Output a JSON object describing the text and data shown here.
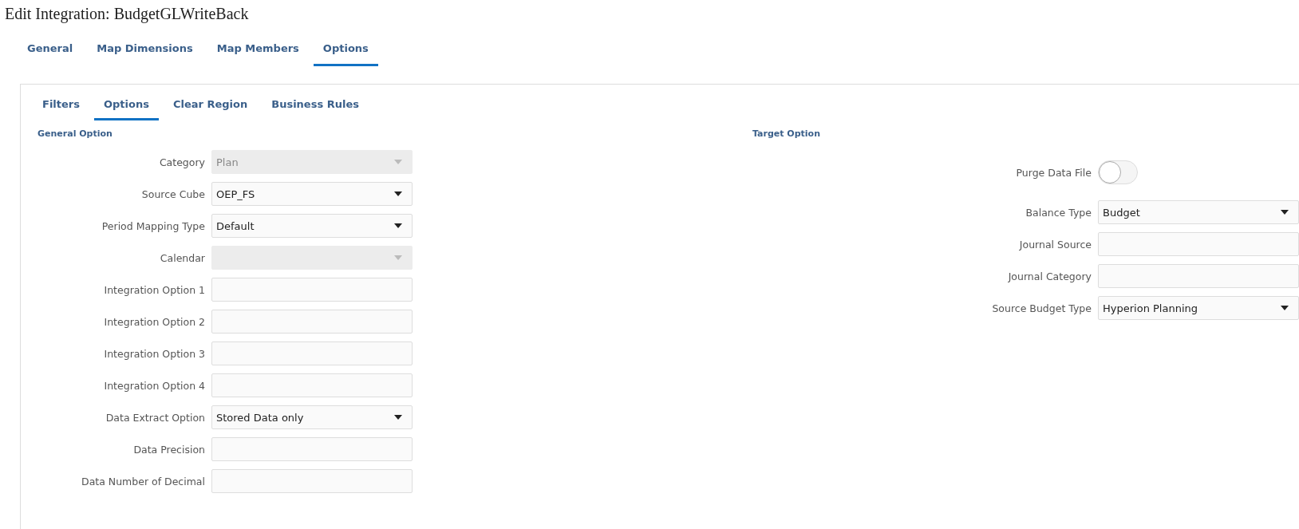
{
  "page_title": "Edit Integration: BudgetGLWriteBack",
  "tabs": [
    {
      "label": "General",
      "selected": false
    },
    {
      "label": "Map Dimensions",
      "selected": false
    },
    {
      "label": "Map Members",
      "selected": false
    },
    {
      "label": "Options",
      "selected": true
    }
  ],
  "sub_tabs": [
    {
      "label": "Filters",
      "selected": false
    },
    {
      "label": "Options",
      "selected": true
    },
    {
      "label": "Clear Region",
      "selected": false
    },
    {
      "label": "Business Rules",
      "selected": false
    }
  ],
  "general_option": {
    "heading": "General Option",
    "fields": [
      {
        "label": "Category",
        "kind": "select",
        "value": "Plan",
        "disabled": true
      },
      {
        "label": "Source Cube",
        "kind": "select",
        "value": "OEP_FS",
        "disabled": false
      },
      {
        "label": "Period Mapping Type",
        "kind": "select",
        "value": "Default",
        "disabled": false
      },
      {
        "label": "Calendar",
        "kind": "select",
        "disabled": true
      },
      {
        "label": "Integration Option 1",
        "kind": "text",
        "disabled": false
      },
      {
        "label": "Integration Option 2",
        "kind": "text",
        "disabled": false
      },
      {
        "label": "Integration Option 3",
        "kind": "text",
        "disabled": false
      },
      {
        "label": "Integration Option 4",
        "kind": "text",
        "disabled": false
      },
      {
        "label": "Data Extract Option",
        "kind": "select",
        "value": "Stored Data only",
        "disabled": false
      },
      {
        "label": "Data Precision",
        "kind": "text",
        "disabled": false
      },
      {
        "label": "Data Number of Decimal",
        "kind": "text",
        "disabled": false
      }
    ]
  },
  "target_option": {
    "heading": "Target Option",
    "fields": [
      {
        "label": "Purge Data File",
        "kind": "toggle",
        "on": false
      },
      {
        "label": "Balance Type",
        "kind": "select",
        "value": "Budget",
        "disabled": false
      },
      {
        "label": "Journal Source",
        "kind": "text",
        "disabled": false
      },
      {
        "label": "Journal Category",
        "kind": "text",
        "disabled": false
      },
      {
        "label": "Source Budget Type",
        "kind": "select",
        "value": "Hyperion Planning",
        "disabled": false
      }
    ]
  }
}
